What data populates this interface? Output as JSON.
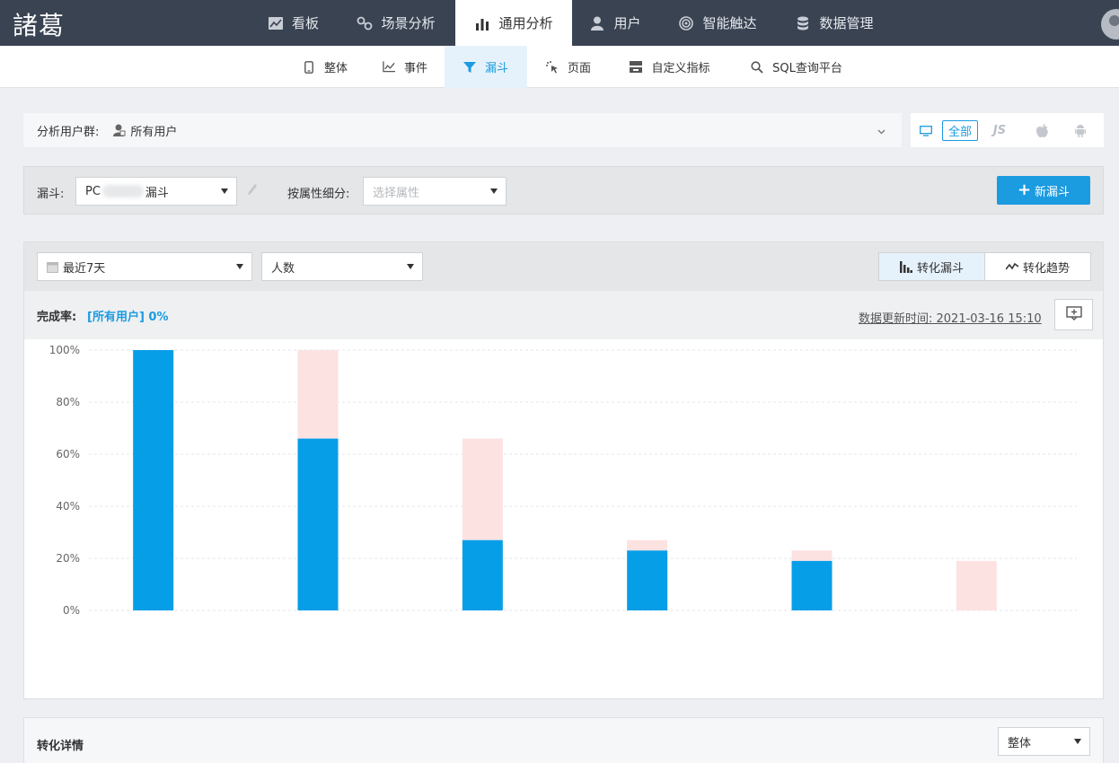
{
  "brand": {
    "logo_text": "諸葛"
  },
  "top_nav": {
    "items": [
      {
        "label": "看板",
        "icon": "chart-area-icon",
        "active": false
      },
      {
        "label": "场景分析",
        "icon": "scene-link-icon",
        "active": false
      },
      {
        "label": "通用分析",
        "icon": "bar-chart-icon",
        "active": true
      },
      {
        "label": "用户",
        "icon": "user-icon",
        "active": false
      },
      {
        "label": "智能触达",
        "icon": "target-icon",
        "active": false
      },
      {
        "label": "数据管理",
        "icon": "database-icon",
        "active": false
      }
    ]
  },
  "sub_nav": {
    "items": [
      {
        "label": "整体",
        "icon": "mobile-icon",
        "active": false
      },
      {
        "label": "事件",
        "icon": "line-chart-icon",
        "active": false
      },
      {
        "label": "漏斗",
        "icon": "funnel-icon",
        "active": true
      },
      {
        "label": "页面",
        "icon": "pointer-icon",
        "active": false
      },
      {
        "label": "自定义指标",
        "icon": "custom-metric-icon",
        "active": false
      },
      {
        "label": "SQL查询平台",
        "icon": "search-icon",
        "active": false
      }
    ]
  },
  "user_group": {
    "label": "分析用户群:",
    "value": "所有用户"
  },
  "platforms": {
    "all_label": "全部",
    "js_label": "JS",
    "items": [
      "desktop-icon",
      "js-icon",
      "apple-icon",
      "android-icon"
    ]
  },
  "funnel_bar": {
    "funnel_label": "漏斗:",
    "funnel_value_prefix": "PC",
    "funnel_value_suffix": "漏斗",
    "breakdown_label": "按属性细分:",
    "breakdown_placeholder": "选择属性",
    "new_button": "新漏斗"
  },
  "toolbar": {
    "date_range": "最近7天",
    "metric": "人数",
    "tabs": [
      {
        "label": "转化漏斗",
        "icon": "bar-chart-icon",
        "active": true
      },
      {
        "label": "转化趋势",
        "icon": "trend-line-icon",
        "active": false
      }
    ]
  },
  "completion": {
    "label": "完成率:",
    "value": "[所有用户] 0%",
    "updated": "数据更新时间: 2021-03-16 15:10"
  },
  "colors": {
    "accent": "#1b9be0",
    "nav_bg": "#3a4352",
    "drop_bar": "#fde2e2",
    "bar": "#079ee8"
  },
  "chart_data": {
    "type": "bar",
    "stacked": true,
    "categories": [
      "",
      "",
      "",
      "",
      "",
      ""
    ],
    "ylim": [
      0,
      100
    ],
    "y_ticks": [
      "0%",
      "20%",
      "40%",
      "60%",
      "80%",
      "100%"
    ],
    "grid": true,
    "series": [
      {
        "values": [
          100,
          66,
          27,
          23,
          19,
          0
        ]
      },
      {
        "values": [
          0,
          34,
          39,
          4,
          4,
          19
        ]
      }
    ]
  },
  "details": {
    "title": "转化详情",
    "scope": "整体"
  }
}
